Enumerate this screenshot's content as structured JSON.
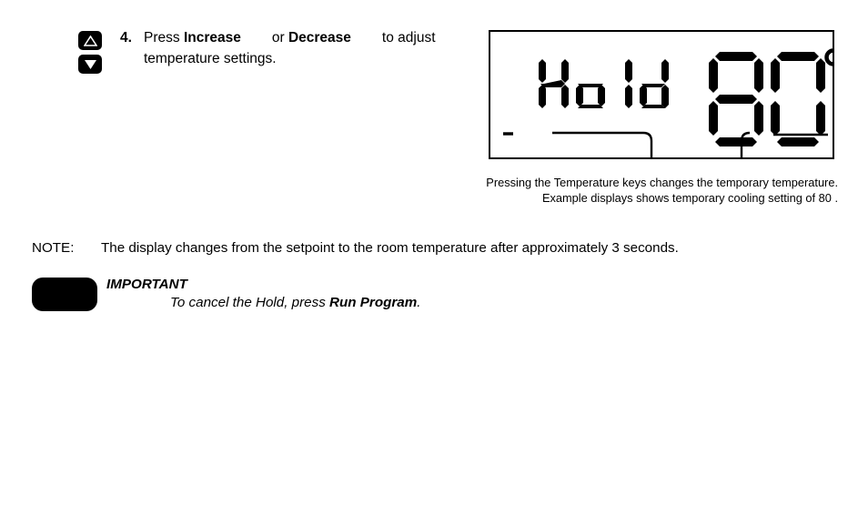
{
  "step": {
    "number": "4.",
    "text_before_increase": "Press ",
    "increase_label": "Increase",
    "text_between": "or ",
    "decrease_label": "Decrease",
    "text_after": "to adjust",
    "line2": "temperature settings."
  },
  "display": {
    "mode_text": "Hold",
    "temperature": "80",
    "degree_symbol": "°",
    "border_color": "#000000",
    "segment_color": "#000000",
    "background": "#ffffff"
  },
  "caption": {
    "line1": "Pressing the Temperature keys changes the temporary temperature.",
    "line2": "Example displays shows temporary cooling setting of 80 ."
  },
  "note": {
    "label": "NOTE:",
    "text": "The display changes from the setpoint to the room temperature after approximately 3 seconds."
  },
  "important": {
    "title": "IMPORTANT",
    "body_before": "To cancel the Hold, press ",
    "button_label": "Run Program",
    "body_after": "."
  },
  "keys": {
    "increase_icon": "triangle-up-icon",
    "decrease_icon": "triangle-down-icon"
  }
}
